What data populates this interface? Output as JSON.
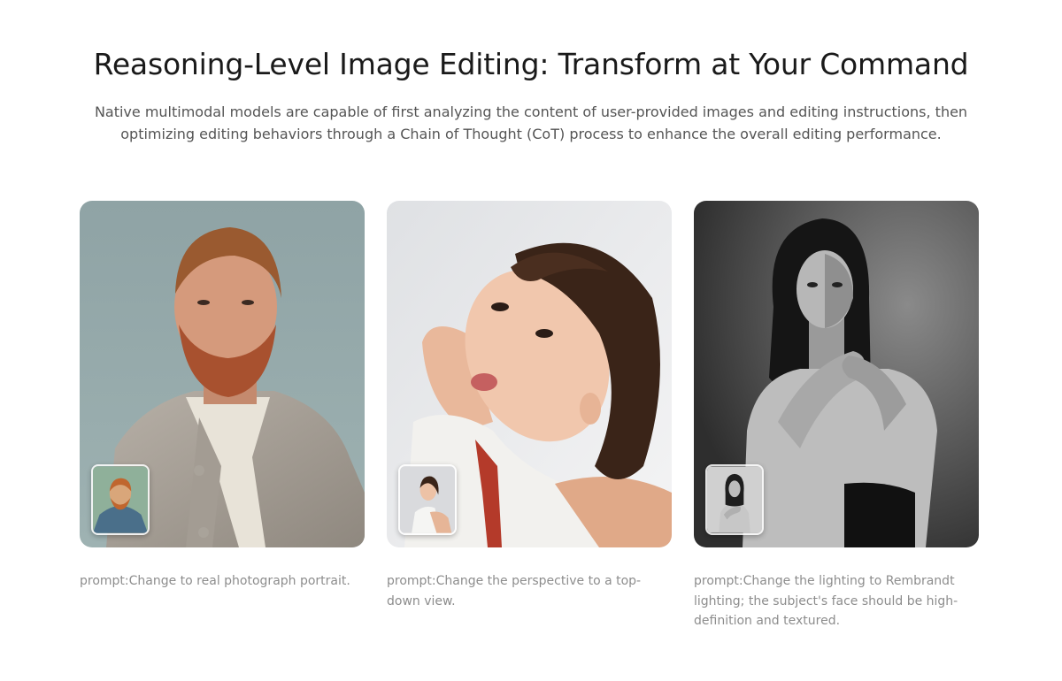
{
  "hero": {
    "title": "Reasoning-Level Image Editing: Transform at Your Command",
    "subtitle": "Native multimodal models are capable of first analyzing the content of user-provided images and editing instructions, then optimizing editing behaviors through a Chain of Thought (CoT) process to enhance the overall editing performance."
  },
  "cards": [
    {
      "prompt": "prompt:Change to real photograph portrait.",
      "image": "bearded-man-portrait",
      "thumbnail": "painted-self-portrait"
    },
    {
      "prompt": "prompt:Change the perspective to a top-down view.",
      "image": "woman-short-hair-top-down",
      "thumbnail": "woman-side-view"
    },
    {
      "prompt": "prompt:Change the lighting to Rembrandt lighting; the subject's face should be high-definition and textured.",
      "image": "woman-black-and-white-portrait",
      "thumbnail": "woman-flat-lit-portrait"
    }
  ],
  "colors": {
    "title": "#1a1a1a",
    "subtitle": "#555555",
    "prompt": "#8d8d8d",
    "background": "#ffffff"
  }
}
